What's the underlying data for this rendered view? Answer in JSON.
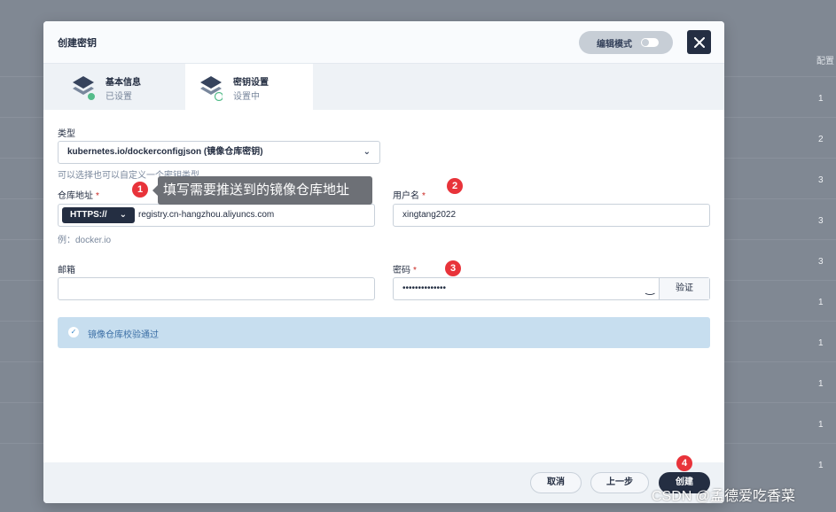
{
  "background": {
    "column_header": "配置",
    "values": [
      "1",
      "2",
      "3",
      "3",
      "3",
      "1",
      "1",
      "1",
      "1",
      "1"
    ]
  },
  "modal": {
    "title": "创建密钥",
    "edit_mode_label": "编辑模式",
    "tabs": [
      {
        "title": "基本信息",
        "subtitle": "已设置",
        "status_color": "#55bc8a"
      },
      {
        "title": "密钥设置",
        "subtitle": "设置中",
        "status_color": "#55bc8a"
      }
    ]
  },
  "form": {
    "type": {
      "label": "类型",
      "value": "kubernetes.io/dockerconfigjson (镜像仓库密钥)",
      "hint": "可以选择也可以自定义一个密钥类型"
    },
    "registry": {
      "label": "仓库地址",
      "required": "*",
      "protocol": "HTTPS://",
      "value": "registry.cn-hangzhou.aliyuncs.com",
      "hint": "例：docker.io"
    },
    "username": {
      "label": "用户名",
      "required": "*",
      "value": "xingtang2022"
    },
    "email": {
      "label": "邮箱",
      "value": ""
    },
    "password": {
      "label": "密码",
      "required": "*",
      "value": "••••••••••••••",
      "verify_label": "验证"
    },
    "success_message": "镜像仓库校验通过"
  },
  "footer": {
    "cancel_label": "取消",
    "prev_label": "上一步",
    "create_label": "创建"
  },
  "annotations": {
    "badges": [
      "1",
      "2",
      "3",
      "4"
    ],
    "tooltip": "填写需要推送到的镜像仓库地址",
    "watermark": "CSDN @孟德爱吃香菜"
  }
}
